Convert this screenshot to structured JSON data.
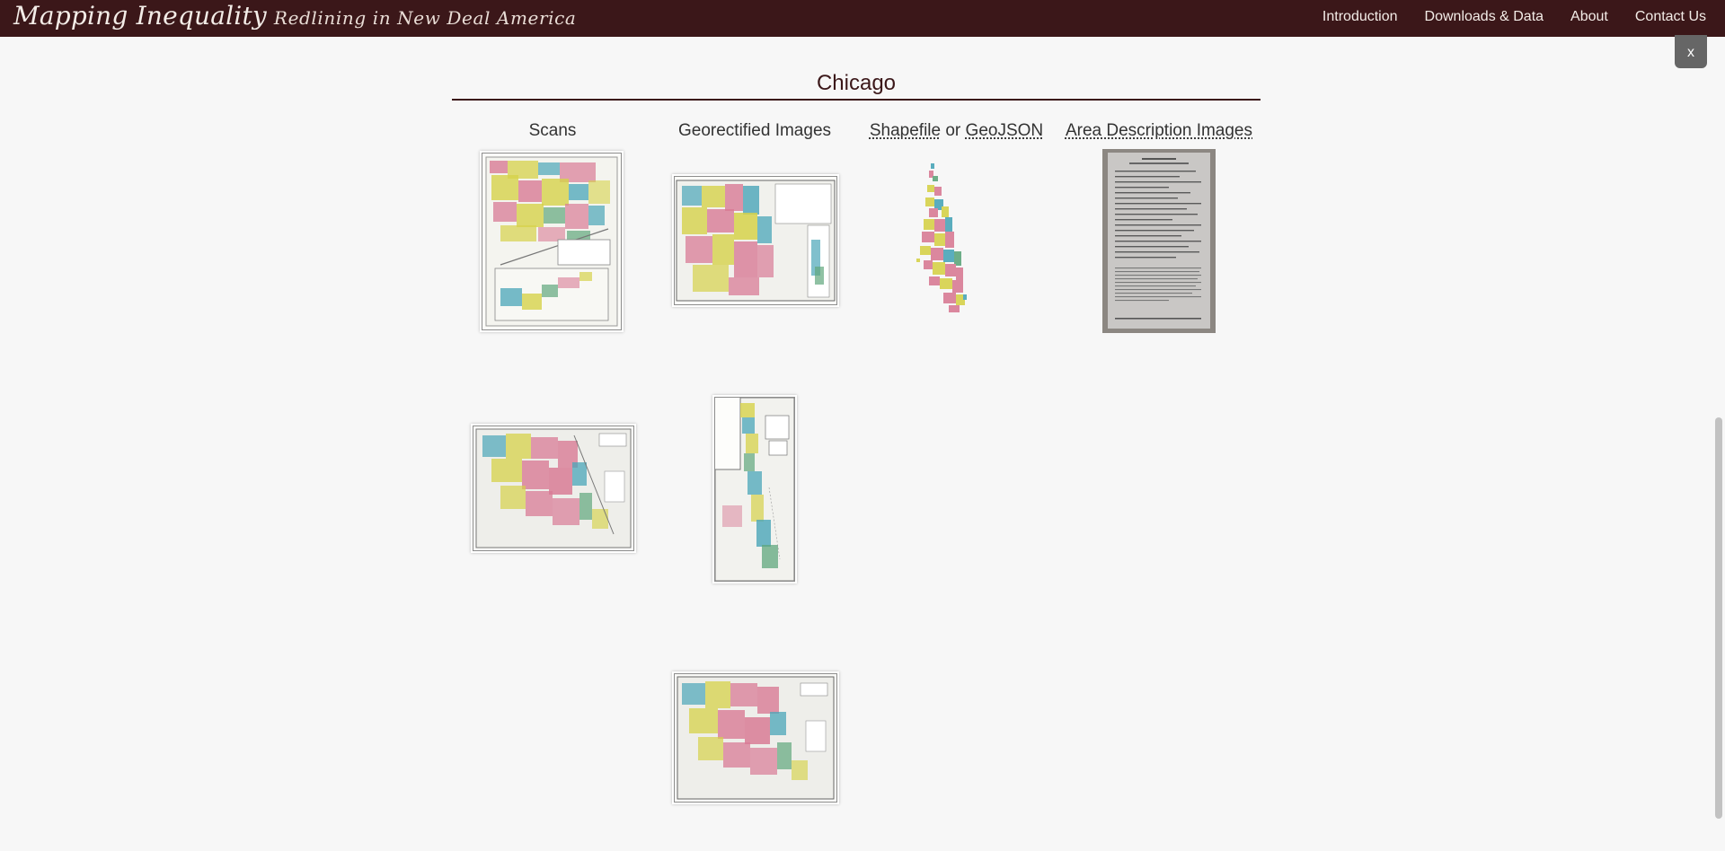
{
  "header": {
    "title": "Mapping Inequality",
    "subtitle": "Redlining in New Deal America",
    "nav": [
      "Introduction",
      "Downloads & Data",
      "About",
      "Contact Us"
    ],
    "background_color": "#3b1719"
  },
  "panel": {
    "close_label": "x",
    "city": "Chicago",
    "columns": {
      "scans": "Scans",
      "georectified": "Georectified Images",
      "shapefile_link": "Shapefile",
      "or_text": "or",
      "geojson_link": "GeoJSON",
      "area_descriptions": "Area Description Images"
    },
    "thumbnails": {
      "scans": [
        "scan-map-thumbnail",
        "scan-map-thumbnail"
      ],
      "georectified": [
        "georectified-map-thumbnail",
        "georectified-map-thumbnail",
        "georectified-map-thumbnail"
      ],
      "shapefile": [
        "chicago-shape-thumbnail"
      ],
      "area_descriptions": [
        "area-description-document-thumbnail"
      ]
    },
    "map_colors": {
      "A": "#5fa77c",
      "B": "#4aa5b8",
      "C": "#d6d24a",
      "D": "#d87b95"
    }
  }
}
